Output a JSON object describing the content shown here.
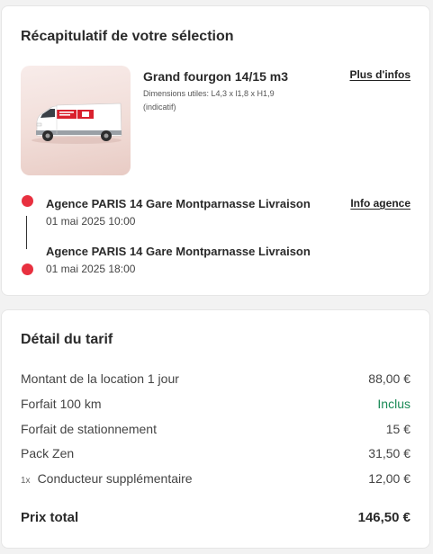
{
  "summary": {
    "title": "Récapitulatif de votre sélection",
    "vehicle": {
      "name": "Grand fourgon 14/15 m3",
      "dimensions": "Dimensions utiles: L4,3 x l1,8 x H1,9 (indicatif)",
      "more_info_label": "Plus d'infos"
    },
    "agency_info_label": "Info agence",
    "pickup": {
      "name": "Agence PARIS 14 Gare Montparnasse Livraison",
      "date": "01 mai 2025 10:00"
    },
    "return": {
      "name": "Agence PARIS 14 Gare Montparnasse Livraison",
      "date": "01 mai 2025 18:00"
    }
  },
  "pricing": {
    "title": "Détail du tarif",
    "rows": [
      {
        "label": "Montant de la location 1 jour",
        "value": "88,00 €"
      },
      {
        "label": "Forfait 100 km",
        "value": "Inclus"
      },
      {
        "label": "Forfait de stationnement",
        "value": "15 €"
      },
      {
        "label": "Pack Zen",
        "value": "31,50 €"
      },
      {
        "qty": "1x",
        "label": "Conducteur supplémentaire",
        "value": "12,00 €"
      }
    ],
    "total_label": "Prix total",
    "total_value": "146,50 €"
  },
  "colors": {
    "accent": "#e8303f",
    "included": "#1a8a56"
  }
}
